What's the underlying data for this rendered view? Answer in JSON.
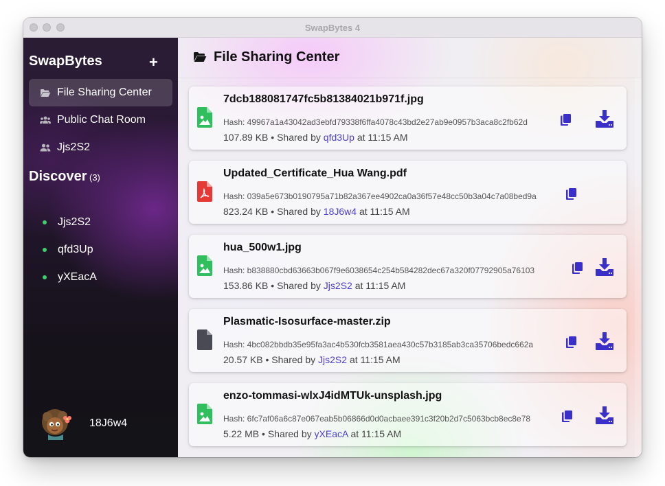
{
  "window": {
    "title": "SwapBytes 4"
  },
  "sidebar": {
    "app_name": "SwapBytes",
    "add_label": "+",
    "items": [
      {
        "label": "File Sharing Center",
        "icon": "folder-open-icon",
        "active": true
      },
      {
        "label": "Public Chat Room",
        "icon": "users-icon",
        "active": false
      },
      {
        "label": "Jjs2S2",
        "icon": "user-group-icon",
        "active": false
      }
    ],
    "discover": {
      "label": "Discover",
      "count": "(3)",
      "peers": [
        {
          "label": "Jjs2S2",
          "status_color": "#3fcf6b"
        },
        {
          "label": "qfd3Up",
          "status_color": "#3fcf6b"
        },
        {
          "label": "yXEacA",
          "status_color": "#3fcf6b"
        }
      ]
    },
    "current_user": {
      "name": "18J6w4",
      "avatar": "cartoon-avatar-icon"
    }
  },
  "main": {
    "title": "File Sharing Center",
    "icon": "folder-open-icon",
    "files": [
      {
        "name": "7dcb188081747fc5b81384021b971f.jpg",
        "type": "image",
        "icon_color": "#2fbf5f",
        "hash": "Hash: 49967a1a43042ad3ebfd79338f6ffa4078c43bd2e27ab9e0957b3aca8c2fb62d",
        "size": "107.89 KB",
        "shared_by_prefix": "• Shared by",
        "user": "qfd3Up",
        "time": "at 11:15 AM",
        "downloadable": true
      },
      {
        "name": "Updated_Certificate_Hua Wang.pdf",
        "type": "pdf",
        "icon_color": "#e53935",
        "hash": "Hash: 039a5e673b0190795a71b82a367ee4902ca0a36f57e48cc50b3a04c7a08bed9a",
        "size": "823.24 KB",
        "shared_by_prefix": "• Shared by",
        "user": "18J6w4",
        "time": "at 11:15 AM",
        "downloadable": false
      },
      {
        "name": "hua_500w1.jpg",
        "type": "image",
        "icon_color": "#2fbf5f",
        "hash": "Hash: b838880cbd63663b067f9e6038654c254b584282dec67a320f07792905a76103",
        "size": "153.86 KB",
        "shared_by_prefix": "• Shared by",
        "user": "Jjs2S2",
        "time": "at 11:15 AM",
        "downloadable": true
      },
      {
        "name": "Plasmatic-Isosurface-master.zip",
        "type": "generic",
        "icon_color": "#4a4a55",
        "hash": "Hash: 4bc082bbdb35e95fa3ac4b530fcb3581aea430c57b3185ab3ca35706bedc662a",
        "size": "20.57 KB",
        "shared_by_prefix": "• Shared by",
        "user": "Jjs2S2",
        "time": "at 11:15 AM",
        "downloadable": true
      },
      {
        "name": "enzo-tommasi-wlxJ4idMTUk-unsplash.jpg",
        "type": "image",
        "icon_color": "#2fbf5f",
        "hash": "Hash: 6fc7af06a6c87e067eab5b06866d0d0acbaee391c3f20b2d7c5063bcb8ec8e78",
        "size": "5.22 MB",
        "shared_by_prefix": "• Shared by",
        "user": "yXEacA",
        "time": "at 11:15 AM",
        "downloadable": true
      }
    ],
    "copy_icon": "copy-icon",
    "download_icon": "download-icon",
    "accent": "#3b2fc9"
  }
}
